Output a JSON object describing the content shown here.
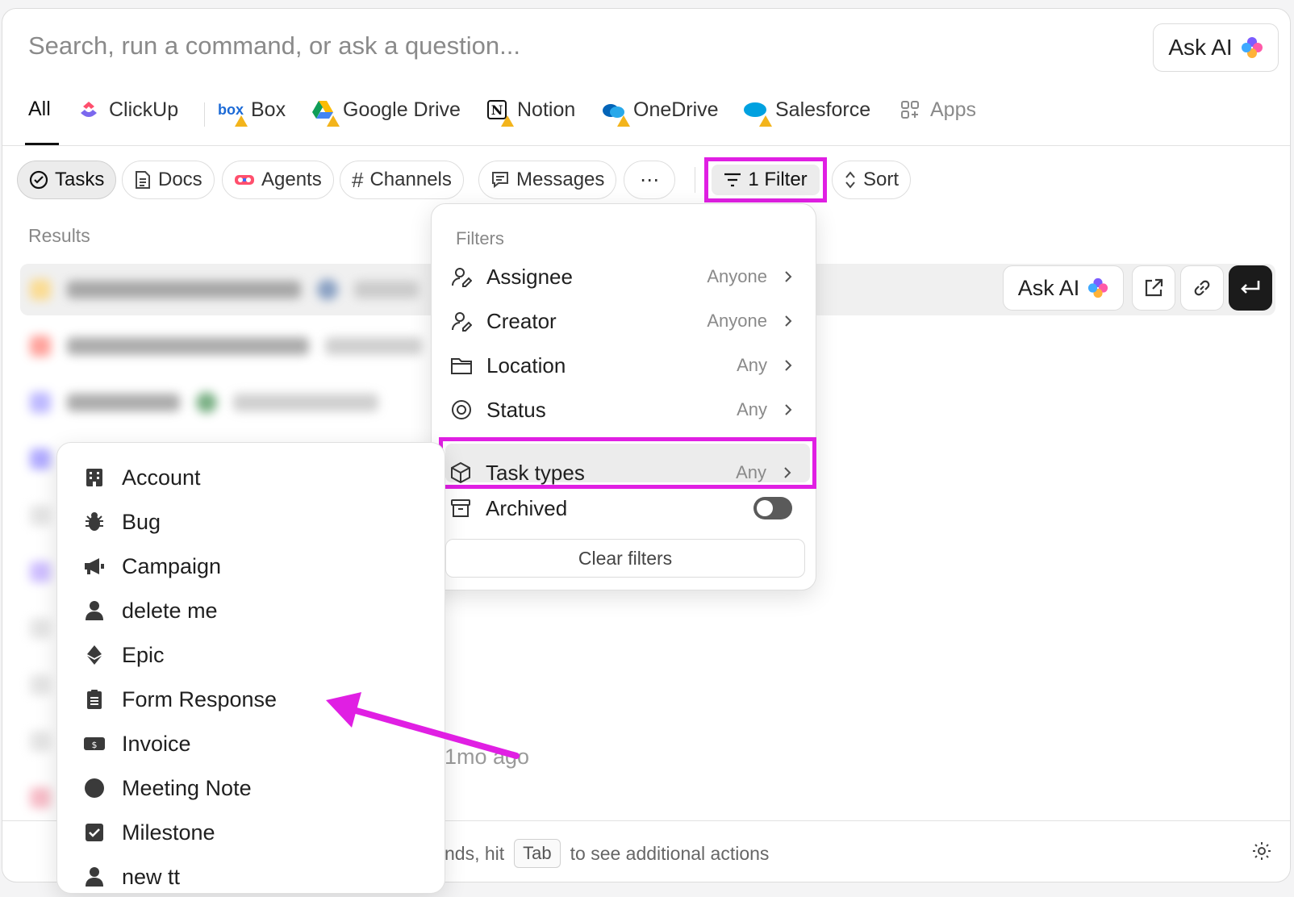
{
  "search": {
    "placeholder": "Search, run a command, or ask a question..."
  },
  "ask_ai": {
    "label": "Ask AI"
  },
  "sources": {
    "all": "All",
    "items": [
      {
        "label": "ClickUp",
        "icon": "clickup-icon"
      },
      {
        "label": "Box",
        "icon": "box-icon"
      },
      {
        "label": "Google Drive",
        "icon": "google-drive-icon"
      },
      {
        "label": "Notion",
        "icon": "notion-icon"
      },
      {
        "label": "OneDrive",
        "icon": "onedrive-icon"
      },
      {
        "label": "Salesforce",
        "icon": "salesforce-icon"
      },
      {
        "label": "Apps",
        "icon": "apps-icon"
      }
    ]
  },
  "chips": {
    "tasks": "Tasks",
    "docs": "Docs",
    "agents": "Agents",
    "channels": "Channels",
    "messages": "Messages",
    "more": "⋯",
    "filter": "1 Filter",
    "sort": "Sort"
  },
  "results": {
    "label": "Results",
    "time_ago": "1mo ago"
  },
  "filters": {
    "title": "Filters",
    "rows": [
      {
        "label": "Assignee",
        "value": "Anyone"
      },
      {
        "label": "Creator",
        "value": "Anyone"
      },
      {
        "label": "Location",
        "value": "Any"
      },
      {
        "label": "Status",
        "value": "Any"
      },
      {
        "label": "Task types",
        "value": "Any"
      },
      {
        "label": "Archived",
        "value": "off"
      }
    ],
    "clear": "Clear filters"
  },
  "task_types": [
    {
      "label": "Account",
      "icon": "building-icon"
    },
    {
      "label": "Bug",
      "icon": "bug-icon"
    },
    {
      "label": "Campaign",
      "icon": "megaphone-icon"
    },
    {
      "label": "delete me",
      "icon": "person-icon"
    },
    {
      "label": "Epic",
      "icon": "diamond-icon"
    },
    {
      "label": "Form Response",
      "icon": "clipboard-icon"
    },
    {
      "label": "Invoice",
      "icon": "money-icon"
    },
    {
      "label": "Meeting Note",
      "icon": "circle-icon"
    },
    {
      "label": "Milestone",
      "icon": "checkbox-icon"
    },
    {
      "label": "new tt",
      "icon": "person-icon"
    }
  ],
  "footer": {
    "prefix": "nds, hit",
    "key": "Tab",
    "suffix": "to see additional actions"
  },
  "colors": {
    "highlight": "#e01fe3",
    "accent_dark": "#1b1b1b"
  }
}
